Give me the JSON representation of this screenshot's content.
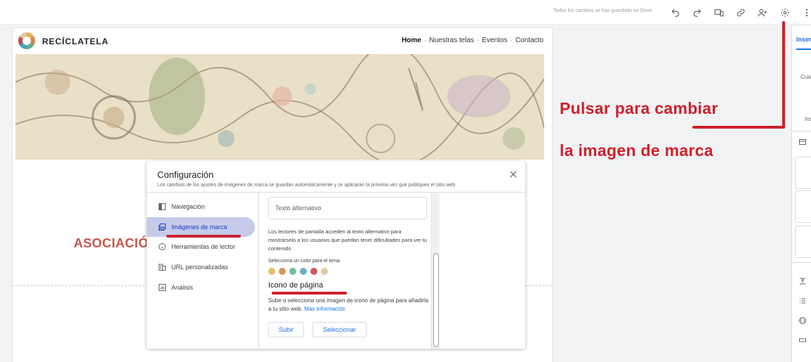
{
  "toolbar": {
    "save_status": "Todos los cambios se han guardado en Drive",
    "icons": [
      "undo-icon",
      "redo-icon",
      "preview-icon",
      "link-icon",
      "share-icon",
      "settings-icon",
      "more-icon"
    ]
  },
  "site": {
    "name": "RECÍCLATELA",
    "nav": [
      "Home",
      "Nuestras telas",
      "Eventos",
      "Contacto"
    ],
    "active_nav": "Home",
    "section_title": "ASOCIACIÓ"
  },
  "right_panel": {
    "tab": "Inser",
    "text1": "Cua",
    "text2": "Ins"
  },
  "annotation": {
    "line1": "Pulsar para cambiar",
    "line2": "la imagen de marca",
    "color": "#d0202b"
  },
  "dialog": {
    "title": "Configuración",
    "subtitle": "Los cambios de los ajustes de imágenes de marca se guardan automáticamente y se aplicarán la próxima vez que publiques el sitio web",
    "nav": [
      {
        "label": "Navegación",
        "icon": "navigation-icon"
      },
      {
        "label": "Imágenes de marca",
        "icon": "brand-images-icon"
      },
      {
        "label": "Herramientas de lector",
        "icon": "info-icon"
      },
      {
        "label": "URL personalizadas",
        "icon": "building-icon"
      },
      {
        "label": "Análisis",
        "icon": "analytics-icon"
      }
    ],
    "active_index": 1,
    "alt_text_placeholder": "Texto alternativo",
    "alt_text_help": "Los lectores de pantalla acceden al texto alternativo para mostrárselo a los usuarios que puedan tener dificultades para ver tu contenido",
    "color_label": "Selecciona un color para el tema",
    "theme_colors": [
      "#e8c06a",
      "#d9955a",
      "#6dbf9e",
      "#6aaec7",
      "#c95a5a",
      "#e0c9a4"
    ],
    "favicon_title": "Icono de página",
    "favicon_desc": "Sube o selecciona una imagen de icono de página para añadirla a tu sitio web.",
    "favicon_link": "Más información",
    "upload_button": "Subir",
    "select_button": "Seleccionar"
  }
}
